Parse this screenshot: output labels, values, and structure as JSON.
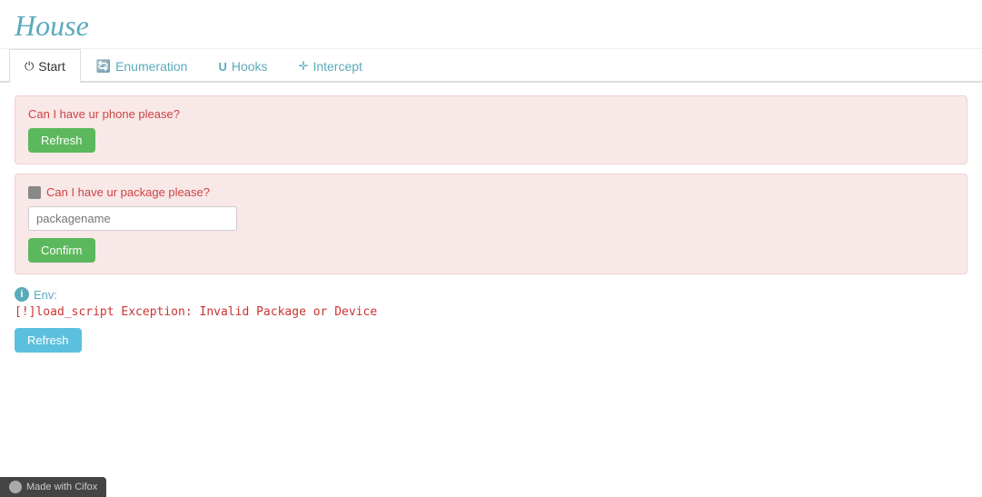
{
  "app": {
    "title": "House"
  },
  "tabs": [
    {
      "id": "start",
      "label": "Start",
      "icon": "⏻",
      "active": true
    },
    {
      "id": "enumeration",
      "label": "Enumeration",
      "icon": "🔄"
    },
    {
      "id": "hooks",
      "label": "Hooks",
      "icon": "U"
    },
    {
      "id": "intercept",
      "label": "Intercept",
      "icon": "✛"
    }
  ],
  "card1": {
    "question": "Can I have ur phone please?",
    "button_label": "Refresh"
  },
  "card2": {
    "icon": "■",
    "question": "Can I have ur package please?",
    "input_placeholder": "packagename",
    "button_label": "Confirm"
  },
  "env": {
    "label": "Env:",
    "error_text": "[!]load_script Exception: Invalid Package or Device",
    "refresh_button_label": "Refresh"
  },
  "footer": {
    "label": "Made with Cifox"
  }
}
